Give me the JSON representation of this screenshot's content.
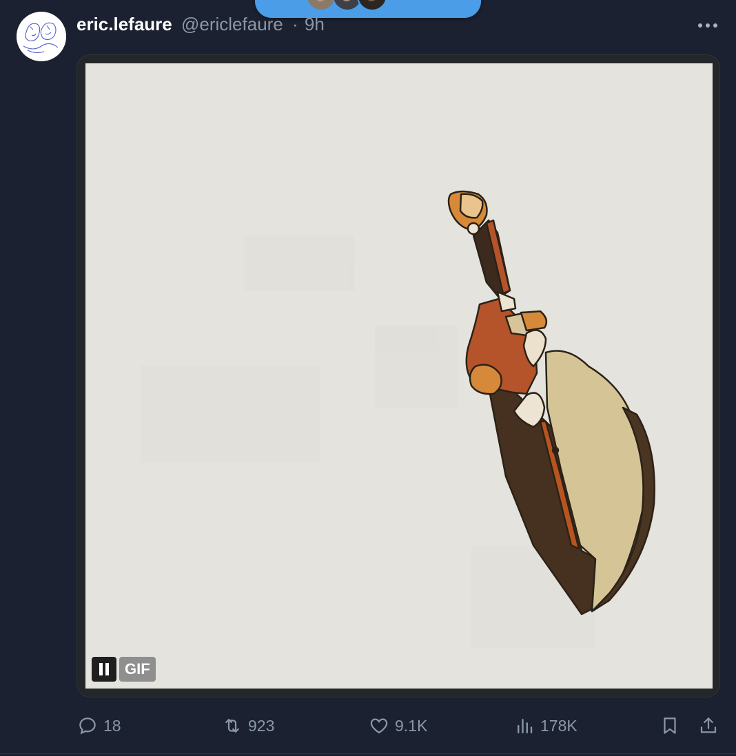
{
  "post": {
    "display_name": "eric.lefaure",
    "handle": "@ericlefaure",
    "separator": "·",
    "time": "9h"
  },
  "media": {
    "badge": "GIF"
  },
  "actions": {
    "replies": "18",
    "reposts": "923",
    "likes": "9.1K",
    "views": "178K"
  },
  "colors": {
    "background": "#1b2130",
    "pill": "#4a9de6",
    "secondary_text": "#8b98a5"
  }
}
